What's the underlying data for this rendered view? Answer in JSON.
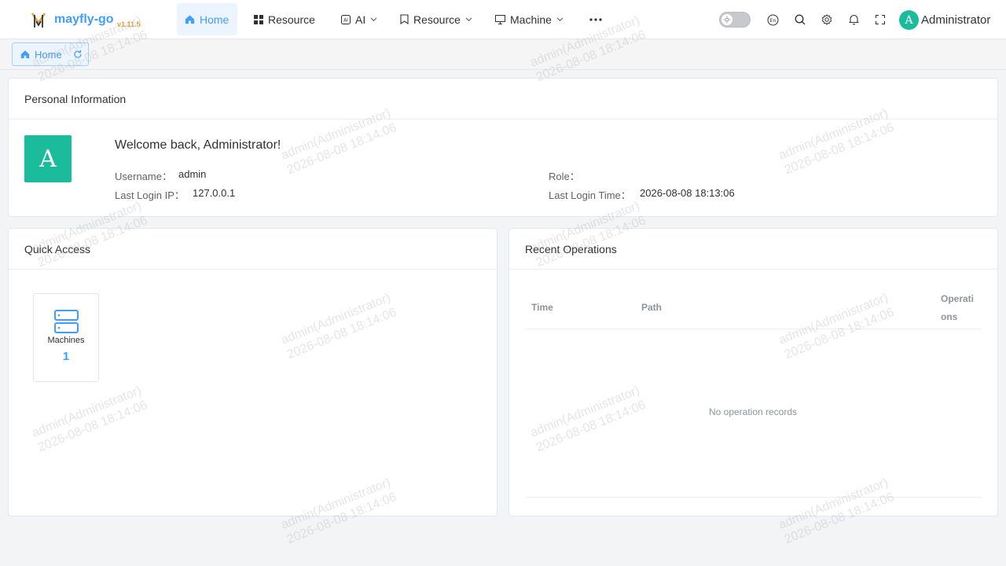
{
  "header": {
    "brand": "mayfly-go",
    "version": "v1.11.5",
    "nav": [
      {
        "label": "Home",
        "icon": "home-icon",
        "active": true,
        "dropdown": false
      },
      {
        "label": "Resource",
        "icon": "grid-icon",
        "active": false,
        "dropdown": false
      },
      {
        "label": "AI",
        "icon": "ai-icon",
        "active": false,
        "dropdown": true
      },
      {
        "label": "Resource",
        "icon": "bookmark-icon",
        "active": false,
        "dropdown": true
      },
      {
        "label": "Machine",
        "icon": "monitor-icon",
        "active": false,
        "dropdown": true
      }
    ],
    "more_icon": "more-icon",
    "theme_toggle": "off",
    "icons": [
      "language-icon",
      "search-icon",
      "gear-icon",
      "bell-icon",
      "fullscreen-icon"
    ],
    "user": {
      "initial": "A",
      "name": "Administrator"
    }
  },
  "tags": {
    "home_label": "Home"
  },
  "personal_info": {
    "title": "Personal Information",
    "avatar_initial": "A",
    "welcome": "Welcome back, Administrator!",
    "username_label": "Username：",
    "username": "admin",
    "ip_label": "Last Login IP：",
    "ip": "127.0.0.1",
    "role_label": "Role：",
    "role": "",
    "login_time_label": "Last Login Time：",
    "login_time": "2026-08-08 18:13:06"
  },
  "quick_access": {
    "title": "Quick Access",
    "items": [
      {
        "label": "Machines",
        "count": "1",
        "icon": "server-icon"
      }
    ]
  },
  "recent_operations": {
    "title": "Recent Operations",
    "columns": [
      "Time",
      "Path",
      "Operati",
      "ons"
    ],
    "empty_text": "No operation records"
  },
  "watermark": {
    "line1": "admin(Administrator)",
    "line2": "2026-08-08 18:14:06"
  },
  "colors": {
    "primary": "#409eff",
    "version": "#e6a23c",
    "avatar": "#1abc9c"
  }
}
